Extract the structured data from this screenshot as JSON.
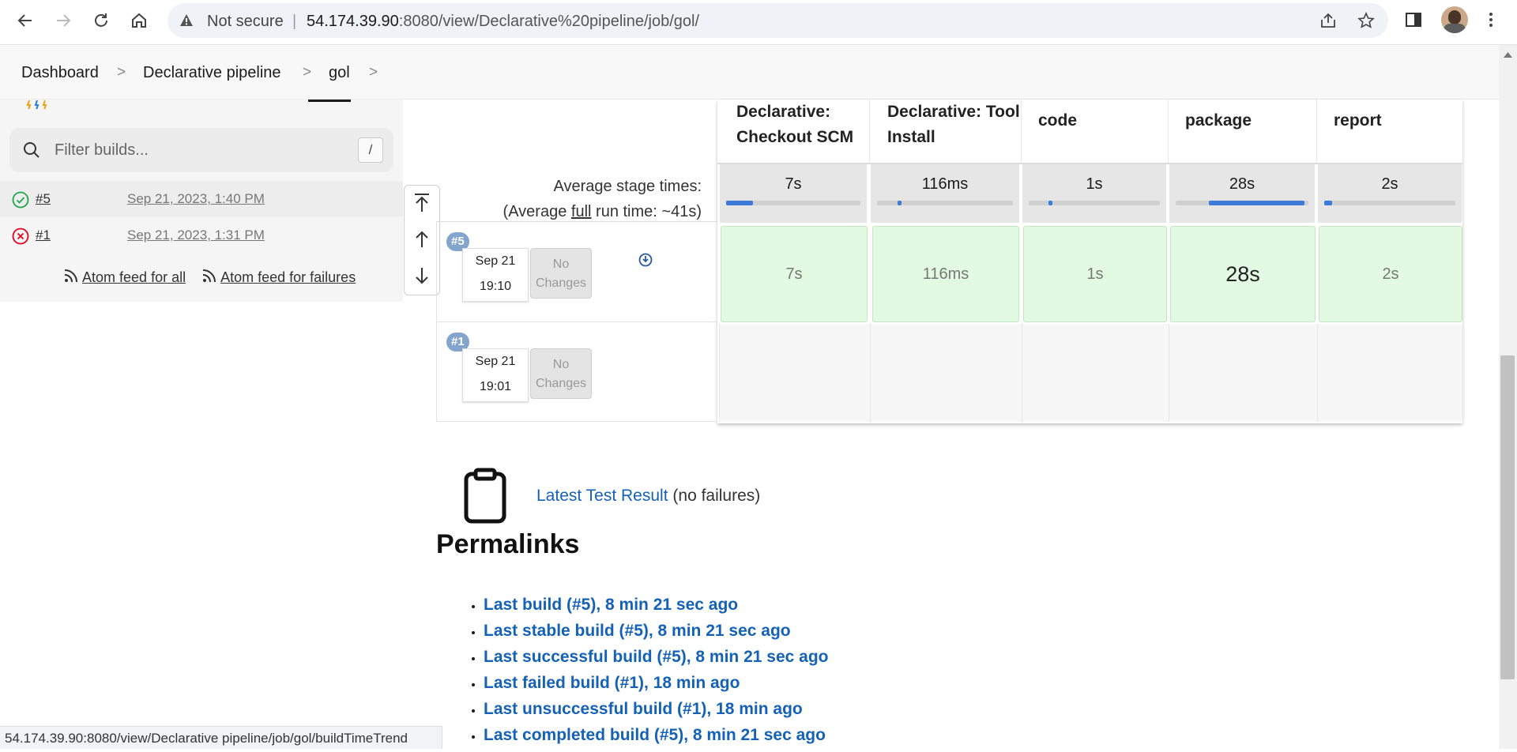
{
  "browser": {
    "security_label": "Not secure",
    "url_host": "54.174.39.90",
    "url_rest": ":8080/view/Declarative%20pipeline/job/gol/"
  },
  "breadcrumb": [
    "Dashboard",
    "Declarative pipeline",
    "gol"
  ],
  "sidebar": {
    "filter_placeholder": "Filter builds...",
    "filter_shortcut": "/",
    "builds": [
      {
        "number": "#5",
        "date": "Sep 21, 2023, 1:40 PM",
        "status": "success"
      },
      {
        "number": "#1",
        "date": "Sep 21, 2023, 1:31 PM",
        "status": "failure"
      }
    ],
    "feed_all": "Atom feed for all",
    "feed_failures": "Atom feed for failures"
  },
  "stage_view": {
    "avg_label": "Average stage times:",
    "avg_full_prefix": "(Average ",
    "avg_full_word": "full",
    "avg_full_suffix": " run time: ~41s)",
    "stages": [
      {
        "name": "Declarative: Checkout SCM",
        "avg": "7s",
        "avg_fill": 0.2
      },
      {
        "name": "Declarative: Tool Install",
        "avg": "116ms",
        "avg_fill": 0.02
      },
      {
        "name": "code",
        "avg": "1s",
        "avg_fill": 0.03
      },
      {
        "name": "package",
        "avg": "28s",
        "avg_fill": 0.72
      },
      {
        "name": "report",
        "avg": "2s",
        "avg_fill": 0.06
      }
    ],
    "runs": [
      {
        "badge": "#5",
        "date": "Sep 21",
        "time": "19:10",
        "changes": "No Changes",
        "cells": [
          "7s",
          "116ms",
          "1s",
          "28s",
          "2s"
        ]
      },
      {
        "badge": "#1",
        "date": "Sep 21",
        "time": "19:01",
        "changes": "No Changes",
        "cells": []
      }
    ]
  },
  "test_result": {
    "link": "Latest Test Result",
    "suffix": "(no failures)"
  },
  "permalinks": {
    "title": "Permalinks",
    "items": [
      "Last build (#5), 8 min 21 sec ago",
      "Last stable build (#5), 8 min 21 sec ago",
      "Last successful build (#5), 8 min 21 sec ago",
      "Last failed build (#1), 18 min ago",
      "Last unsuccessful build (#1), 18 min ago",
      "Last completed build (#5), 8 min 21 sec ago"
    ]
  },
  "statusbar": "54.174.39.90:8080/view/Declarative pipeline/job/gol/buildTimeTrend",
  "colors": {
    "accent": "#1461b8",
    "success": "#1ea64b",
    "failure": "#e6001f",
    "stage_ok": "#e1fae1"
  }
}
